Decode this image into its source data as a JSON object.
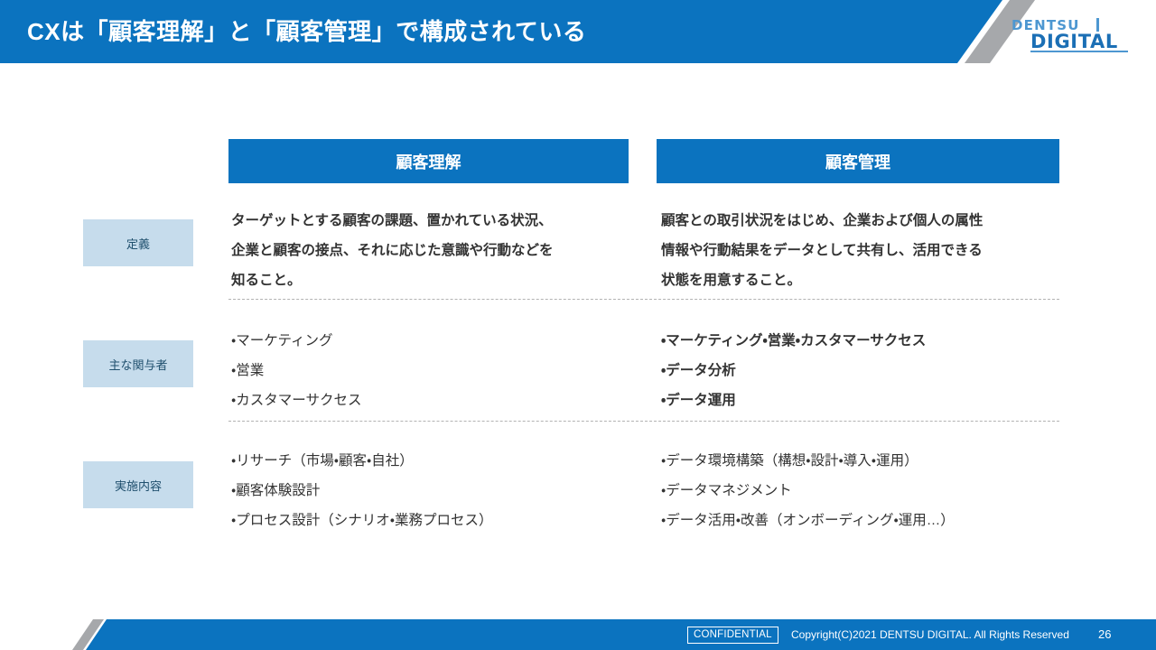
{
  "header": {
    "title": "CXは「顧客理解」と「顧客管理」で構成されている",
    "bar_color": "#0b73bf",
    "stripe_color": "#a6a8ab"
  },
  "logo": {
    "top_text": "DENTSU",
    "bottom_text": "DIGITAL",
    "top_color": "#4d97d1",
    "bottom_color": "#1b6fb5"
  },
  "matrix": {
    "column_headers": [
      {
        "label": "顧客理解"
      },
      {
        "label": "顧客管理"
      }
    ],
    "row_labels": [
      {
        "label": "定義"
      },
      {
        "label": "主な関与者"
      },
      {
        "label": "実施内容"
      }
    ],
    "row_label_bg": "#c6dcec",
    "row_label_color": "#20506e",
    "cells": {
      "definition": {
        "understanding": [
          "ターゲットとする顧客の課題、置かれている状況、",
          "企業と顧客の接点、それに応じた意識や行動などを",
          "知ること。"
        ],
        "management": [
          "顧客との取引状況をはじめ、企業および個人の属性",
          "情報や行動結果をデータとして共有し、活用できる",
          "状態を用意すること。"
        ]
      },
      "stakeholders": {
        "understanding": [
          "・マーケティング",
          "・営業",
          "・カスタマーサクセス"
        ],
        "management": [
          "・マーケティング・営業・カスタマーサクセス",
          "・データ分析",
          "・データ運用"
        ]
      },
      "activities": {
        "understanding": [
          "・リサーチ（市場・顧客・自社）",
          "・顧客体験設計",
          "・プロセス設計（シナリオ・業務プロセス）"
        ],
        "management": [
          "・データ環境構築（構想・設計・導入・運用）",
          "・データマネジメント",
          "・データ活用・改善（オンボーディング・運用…）"
        ]
      }
    }
  },
  "footer": {
    "confidential_label": "CONFIDENTIAL",
    "copyright": "Copyright(C)2021 DENTSU DIGITAL. All Rights Reserved",
    "page_number": "26",
    "bar_color": "#0b73bf"
  }
}
